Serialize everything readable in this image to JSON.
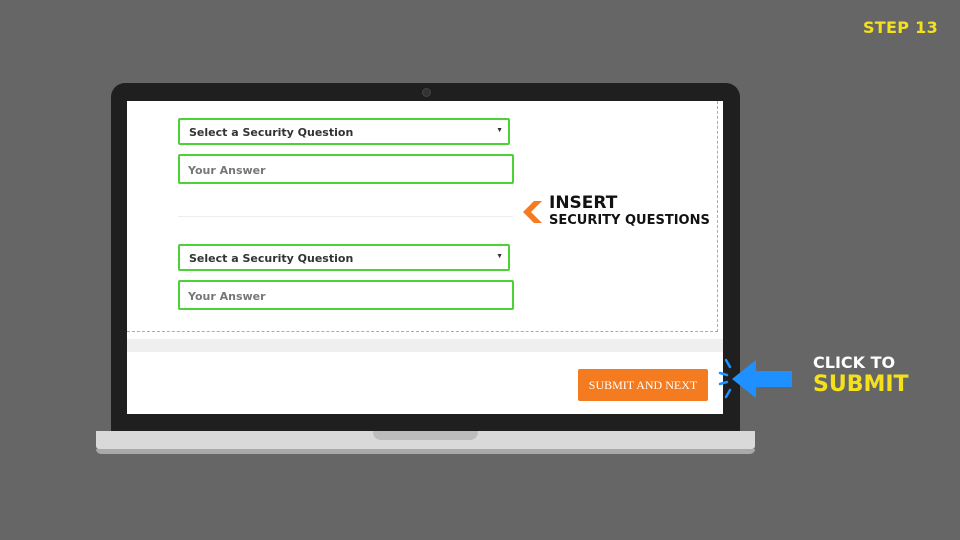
{
  "step_label": "STEP 13",
  "form": {
    "question1": {
      "label": "Select a Security Question",
      "arrow": "▼"
    },
    "answer1": {
      "placeholder": "Your Answer"
    },
    "question2": {
      "label": "Select a Security Question",
      "arrow": "▼"
    },
    "answer2": {
      "placeholder": "Your Answer"
    },
    "submit_label": "SUBMIT AND NEXT"
  },
  "callouts": {
    "insert_title": "INSERT",
    "insert_sub": "SECURITY QUESTIONS",
    "click_line1": "CLICK TO",
    "click_line2": "SUBMIT"
  },
  "colors": {
    "background": "#666666",
    "accent_orange": "#f47b20",
    "field_border_green": "#4cd137",
    "highlight_yellow": "#f5e11b",
    "pointer_blue": "#1e90ff"
  },
  "icons": {
    "chevron": "chevron-left-icon",
    "pointer": "arrow-pointer-icon",
    "camera": "camera-icon"
  }
}
